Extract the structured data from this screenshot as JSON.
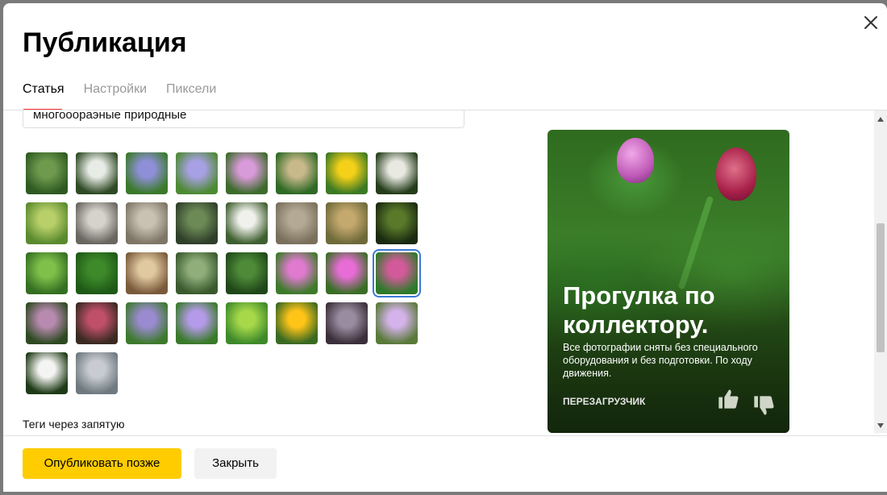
{
  "modal": {
    "title": "Публикация",
    "tabs": [
      {
        "label": "Статья",
        "active": true
      },
      {
        "label": "Настройки",
        "active": false
      },
      {
        "label": "Пиксели",
        "active": false
      }
    ]
  },
  "article": {
    "text_snippet": "многооораэные природные",
    "selected_thumbnail_index": 23,
    "thumbnails": [
      {
        "name": "meadow-hills",
        "colors": [
          "#6f9a4e",
          "#2e5a22"
        ]
      },
      {
        "name": "white-flower-spike",
        "colors": [
          "#e8ece6",
          "#2f4a25"
        ]
      },
      {
        "name": "purple-violet-small",
        "colors": [
          "#8e8fd6",
          "#3a7a2a"
        ]
      },
      {
        "name": "purple-violet-large",
        "colors": [
          "#a8a0e4",
          "#4e8a33"
        ]
      },
      {
        "name": "pink-clover",
        "colors": [
          "#d89ad8",
          "#3d6b2c"
        ]
      },
      {
        "name": "plantain",
        "colors": [
          "#c8b88a",
          "#2f6a26"
        ]
      },
      {
        "name": "yellow-buttercup",
        "colors": [
          "#f4d018",
          "#3d7a24"
        ]
      },
      {
        "name": "white-blossoms",
        "colors": [
          "#e9e9e2",
          "#243d1b"
        ]
      },
      {
        "name": "field-trees",
        "colors": [
          "#b9d06a",
          "#5a8a2e"
        ]
      },
      {
        "name": "gray-bark",
        "colors": [
          "#d6d3cc",
          "#6a6660"
        ]
      },
      {
        "name": "insect-on-stone",
        "colors": [
          "#c9c2b3",
          "#7e7566"
        ]
      },
      {
        "name": "stream-water",
        "colors": [
          "#6c8a56",
          "#2f3f2a"
        ]
      },
      {
        "name": "white-small-flowers",
        "colors": [
          "#f0f0ec",
          "#3f6030"
        ]
      },
      {
        "name": "dry-ground",
        "colors": [
          "#b3a994",
          "#7b705c"
        ]
      },
      {
        "name": "dry-grass",
        "colors": [
          "#c4a86e",
          "#6e6a3a"
        ]
      },
      {
        "name": "dark-leaves",
        "colors": [
          "#5a7a2a",
          "#1a2a10"
        ]
      },
      {
        "name": "ladybug-leaf",
        "colors": [
          "#7fc04a",
          "#356f22"
        ]
      },
      {
        "name": "beetle-leaf",
        "colors": [
          "#3e8a2a",
          "#1e5a16"
        ]
      },
      {
        "name": "mushroom",
        "colors": [
          "#e0c8a0",
          "#7a5a3a"
        ]
      },
      {
        "name": "fern-clusters",
        "colors": [
          "#8fae7a",
          "#3a5a2e"
        ]
      },
      {
        "name": "green-herbs",
        "colors": [
          "#4e8a38",
          "#1f4718"
        ]
      },
      {
        "name": "pink-bud",
        "colors": [
          "#e07ad0",
          "#3e7a2a"
        ]
      },
      {
        "name": "pink-rose",
        "colors": [
          "#e86cd6",
          "#3a6e26"
        ]
      },
      {
        "name": "rose-bud-leaves",
        "colors": [
          "#d25a9a",
          "#2e7a2a"
        ]
      },
      {
        "name": "meadow-flowers",
        "colors": [
          "#b88ab0",
          "#2f4a22"
        ]
      },
      {
        "name": "berries-red",
        "colors": [
          "#c0506a",
          "#3a2a22"
        ]
      },
      {
        "name": "purple-bells-field",
        "colors": [
          "#9a8ad0",
          "#3e7a2e"
        ]
      },
      {
        "name": "purple-bellflower",
        "colors": [
          "#b49ae8",
          "#3a7a2a"
        ]
      },
      {
        "name": "grass-yellow-dots",
        "colors": [
          "#a6d84a",
          "#3e8a2a"
        ]
      },
      {
        "name": "yellow-globe",
        "colors": [
          "#ffc418",
          "#3a6a22"
        ]
      },
      {
        "name": "dry-umbels",
        "colors": [
          "#9a8ca0",
          "#3a2f3a"
        ]
      },
      {
        "name": "lilac-cluster",
        "colors": [
          "#d4b2ea",
          "#5a7a3a"
        ]
      },
      {
        "name": "white-flower-cluster",
        "colors": [
          "#f4f4f2",
          "#1e3a16"
        ]
      },
      {
        "name": "cloudy-sky",
        "colors": [
          "#c8ccd0",
          "#6f7a80"
        ]
      }
    ],
    "tags_label": "Теги через запятую"
  },
  "preview_card": {
    "title": "Прогулка по коллектору.",
    "description": "Все фотографии сняты без специального оборудования и без подготовки. По ходу движения.",
    "author": "ПЕРЕЗАГРУЗЧИК"
  },
  "footer": {
    "publish_later_label": "Опубликовать позже",
    "close_label": "Закрыть"
  },
  "colors": {
    "primary_button": "#ffcc00",
    "secondary_button": "#f2f2f2",
    "active_tab_underline": "#ff3333",
    "selected_thumbnail_outline": "#3a7bd5"
  }
}
